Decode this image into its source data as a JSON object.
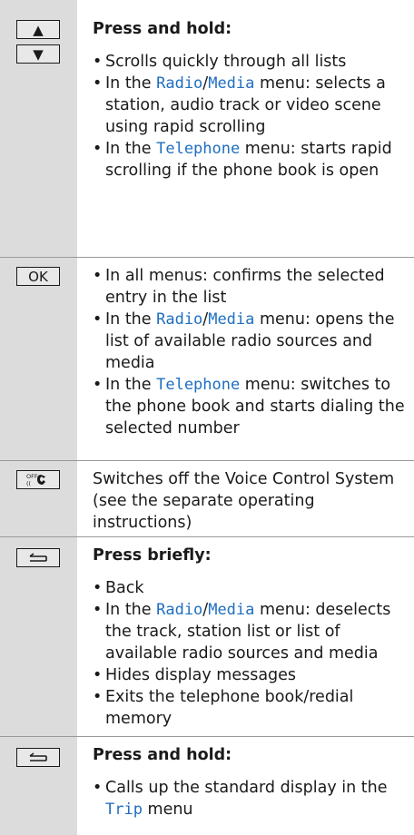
{
  "rows": [
    {
      "keys": [
        "▲",
        "▼"
      ],
      "heading": "Press and hold:",
      "items": [
        {
          "text": "Scrolls quickly through all lists"
        },
        {
          "pre": "In the ",
          "menu1": "Radio",
          "sep": "/",
          "menu2": "Media",
          "post": " menu: selects a station, audio track or video scene using rapid scrolling"
        },
        {
          "pre": "In the ",
          "menu1": "Telephone",
          "post": " menu: starts rapid scrolling if the phone book is open"
        }
      ]
    },
    {
      "keys": [
        "OK"
      ],
      "items": [
        {
          "text": "In all menus: confirms the selected entry in the list"
        },
        {
          "pre": "In the ",
          "menu1": "Radio",
          "sep": "/",
          "menu2": "Media",
          "post": " menu: opens the list of available radio sources and media"
        },
        {
          "pre": "In the ",
          "menu1": "Telephone",
          "post": " menu: switches to the phone book and starts dialing the selected number"
        }
      ]
    },
    {
      "keys": [
        "voice-off"
      ],
      "text": "Switches off the Voice Control System (see the separate operating instructions)"
    },
    {
      "keys": [
        "back"
      ],
      "heading": "Press briefly:",
      "items": [
        {
          "text": "Back"
        },
        {
          "pre": "In the ",
          "menu1": "Radio",
          "sep": "/",
          "menu2": "Media",
          "post": " menu: deselects the track, station list or list of available radio sources and media"
        },
        {
          "text": "Hides display messages"
        },
        {
          "text": "Exits the telephone book/redial memory"
        }
      ]
    },
    {
      "keys": [
        "back"
      ],
      "heading": "Press and hold:",
      "items": [
        {
          "pre": "Calls up the standard display in the ",
          "menu1": "Trip",
          "post": " menu"
        }
      ]
    }
  ]
}
